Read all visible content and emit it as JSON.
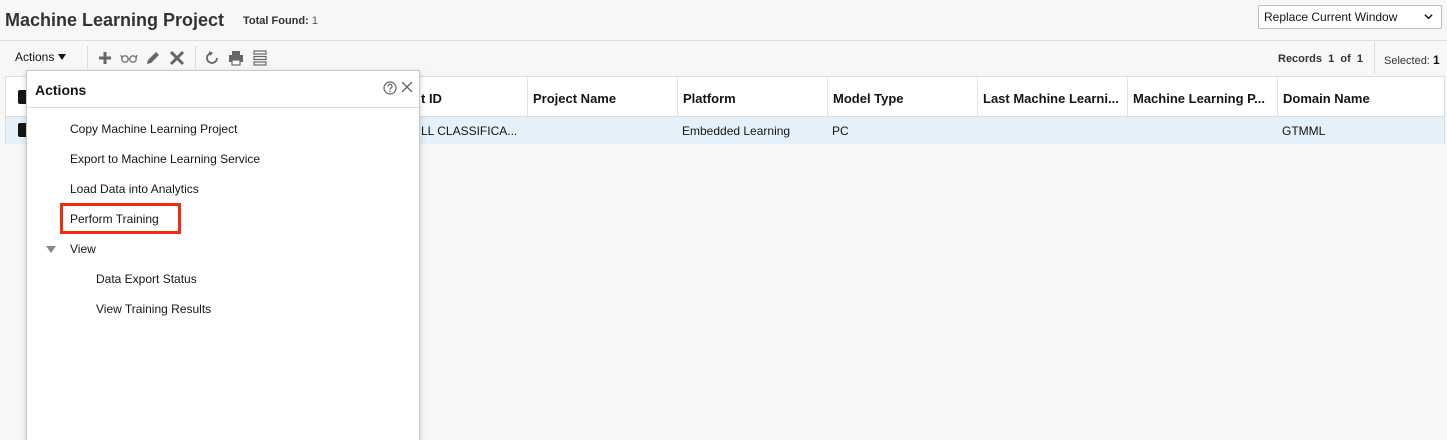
{
  "header": {
    "title": "Machine Learning Project",
    "total_found_label": "Total Found:",
    "total_found_value": "1",
    "window_select_value": "Replace Current Window"
  },
  "toolbar": {
    "actions_label": "Actions",
    "icons": [
      "plus-icon",
      "glasses-icon",
      "pencil-icon",
      "delete-x-icon",
      "refresh-icon",
      "print-icon",
      "list-view-icon"
    ],
    "records_label": "Records",
    "records_current": "1",
    "records_of": "of",
    "records_total": "1",
    "selected_label": "Selected:",
    "selected_value": "1"
  },
  "table": {
    "columns": [
      "t ID",
      "Project Name",
      "Platform",
      "Model Type",
      "Last Machine Learni...",
      "Machine Learning P...",
      "Domain Name"
    ],
    "rows": [
      {
        "project_id": "LL CLASSIFICA...",
        "project_name": "",
        "platform": "Embedded Learning",
        "model_type": "PC",
        "last_ml": "",
        "ml_p": "",
        "domain_name": "GTMML"
      }
    ]
  },
  "actions_popup": {
    "title": "Actions",
    "items": {
      "copy": "Copy Machine Learning Project",
      "export": "Export to Machine Learning Service",
      "load": "Load Data into Analytics",
      "perform": "Perform Training",
      "view": "View",
      "data_export_status": "Data Export Status",
      "view_training_results": "View Training Results"
    }
  },
  "colors": {
    "highlight_box": "#f02d0c",
    "selected_row": "#e4f0fa"
  }
}
